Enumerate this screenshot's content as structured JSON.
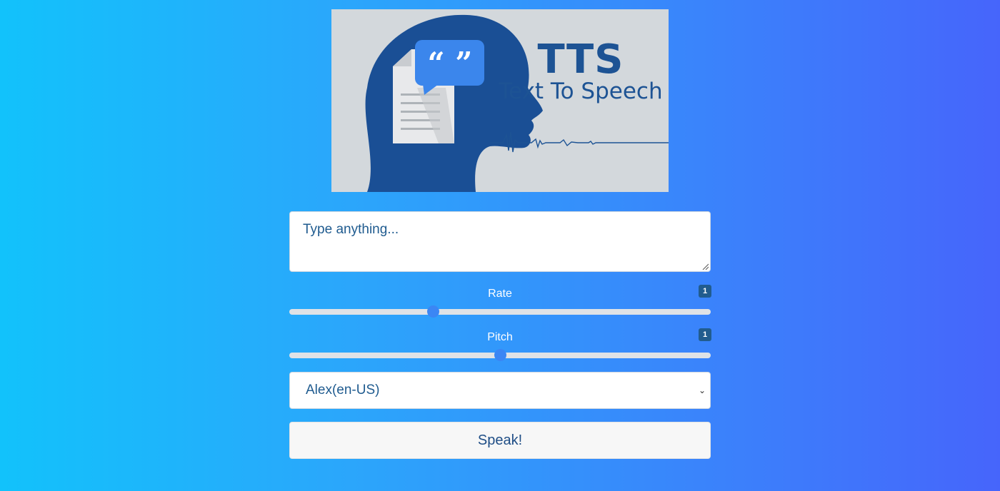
{
  "banner": {
    "title": "TTS",
    "subtitle": "Text To Speech",
    "image_name": "tts-logo"
  },
  "text_input": {
    "placeholder": "Type anything..."
  },
  "rate": {
    "label": "Rate",
    "value_badge": "1",
    "level_fraction": 0.34
  },
  "pitch": {
    "label": "Pitch",
    "value_badge": "1",
    "level_fraction": 0.5
  },
  "voice_select": {
    "selected": "Alex(en-US)"
  },
  "speak_button": {
    "label": "Speak!"
  },
  "colors": {
    "gradient_start": "#12c2fb",
    "gradient_end": "#4665fb",
    "logo_blue": "#1d5394",
    "slider_thumb": "#3b86f4"
  }
}
